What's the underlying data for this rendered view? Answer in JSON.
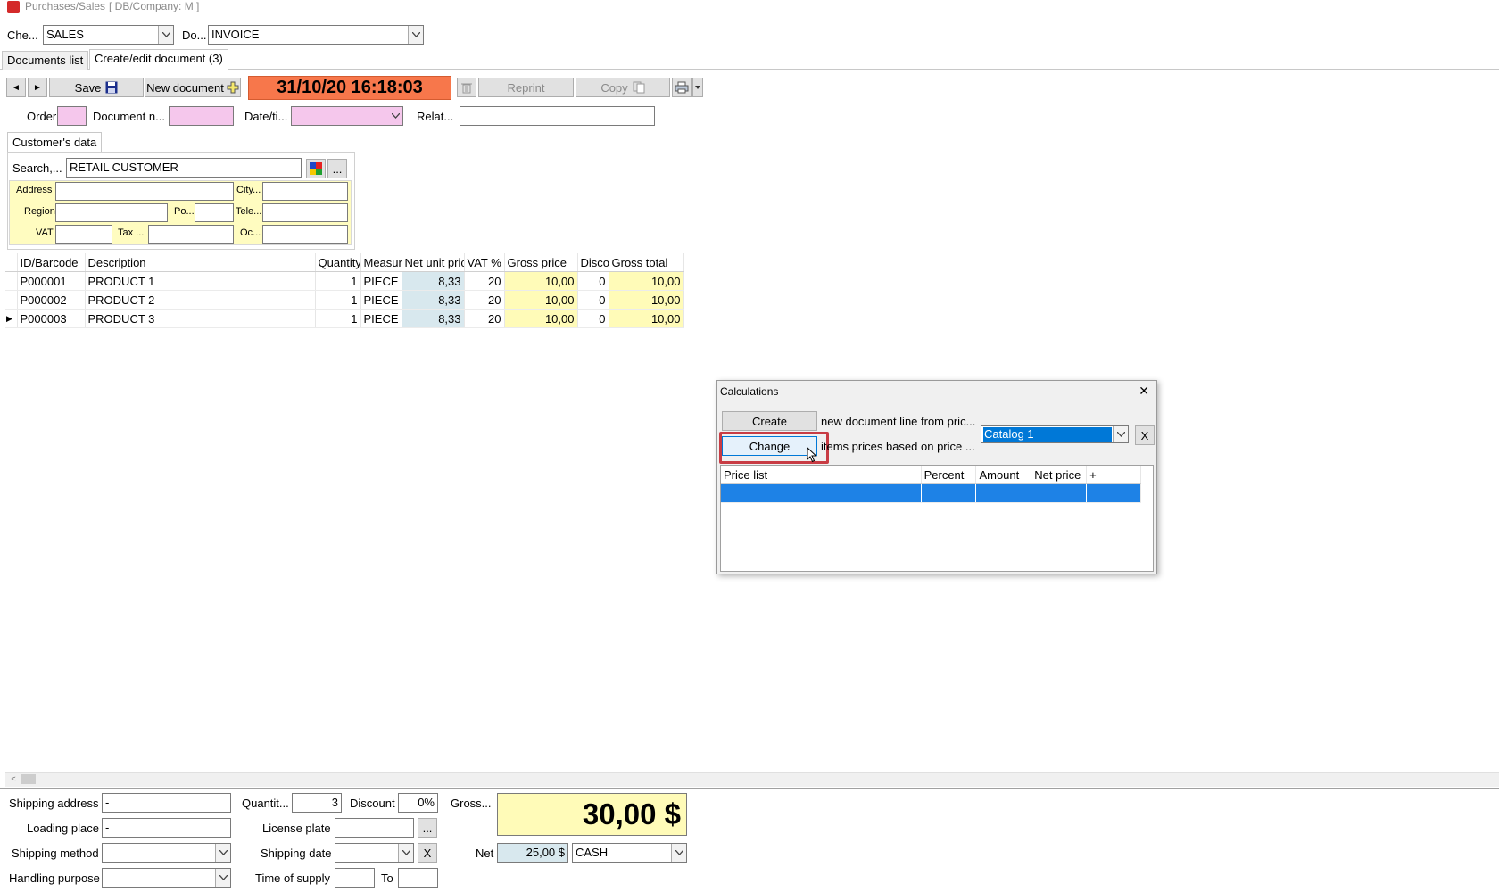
{
  "window": {
    "title": "Purchases/Sales",
    "db_info": "[ DB/Company: M ]"
  },
  "top": {
    "channel_label": "Che...",
    "channel_value": "SALES",
    "doc_label": "Do...",
    "doc_value": "INVOICE"
  },
  "tabs": [
    "Documents list",
    "Create/edit document (3)"
  ],
  "toolbar": {
    "prev": "◄",
    "next": "►",
    "save": "Save",
    "new_document": "New document",
    "datetime": "31/10/20 16:18:03",
    "reprint": "Reprint",
    "copy": "Copy",
    "datetime_bg": "#f7774b"
  },
  "header_fields": {
    "order": "Order",
    "document_no": "Document n...",
    "date_time": "Date/ti...",
    "related": "Relat..."
  },
  "customer": {
    "tab": "Customer's data",
    "search_label": "Search,...",
    "search_value": "RETAIL CUSTOMER",
    "more_button": "...",
    "address": "Address",
    "city": "City...",
    "region": "Region",
    "postal": "Po...",
    "telephone": "Tele...",
    "vat": "VAT",
    "tax": "Tax ...",
    "occupation": "Oc..."
  },
  "items": {
    "columns": [
      "ID/Barcode",
      "Description",
      "Quantity",
      "Measur",
      "Net unit pric",
      "VAT %",
      "Gross price",
      "Disco",
      "Gross total"
    ],
    "rows": [
      [
        "P000001",
        "PRODUCT 1",
        "1",
        "PIECE",
        "8,33",
        "20",
        "10,00",
        "0",
        "10,00"
      ],
      [
        "P000002",
        "PRODUCT 2",
        "1",
        "PIECE",
        "8,33",
        "20",
        "10,00",
        "0",
        "10,00"
      ],
      [
        "P000003",
        "PRODUCT 3",
        "1",
        "PIECE",
        "8,33",
        "20",
        "10,00",
        "0",
        "10,00"
      ]
    ],
    "current_row_marker": "▶"
  },
  "dialog": {
    "title": "Calculations",
    "close": "✕",
    "create_button": "Create",
    "create_text": "new document line from pric...",
    "change_button": "Change",
    "change_text": "items prices based on price ...",
    "catalog_value": "Catalog 1",
    "clear_button": "X",
    "columns": [
      "Price list",
      "Percent",
      "Amount",
      "Net price",
      "+"
    ]
  },
  "footer": {
    "shipping_address": "Shipping address",
    "shipping_address_value": "-",
    "loading_place": "Loading place",
    "loading_place_value": "-",
    "shipping_method": "Shipping method",
    "handling_purpose": "Handling purpose",
    "quantity": "Quantit...",
    "quantity_value": "3",
    "discount": "Discount",
    "discount_value": "0%",
    "license_plate": "License plate",
    "license_more": "...",
    "shipping_date": "Shipping date",
    "shipping_date_clear": "X",
    "time_of_supply": "Time of supply",
    "to": "To",
    "gross": "Gross...",
    "gross_value": "30,00 $",
    "net": "Net",
    "net_value": "25,00 $",
    "payment": "CASH"
  }
}
